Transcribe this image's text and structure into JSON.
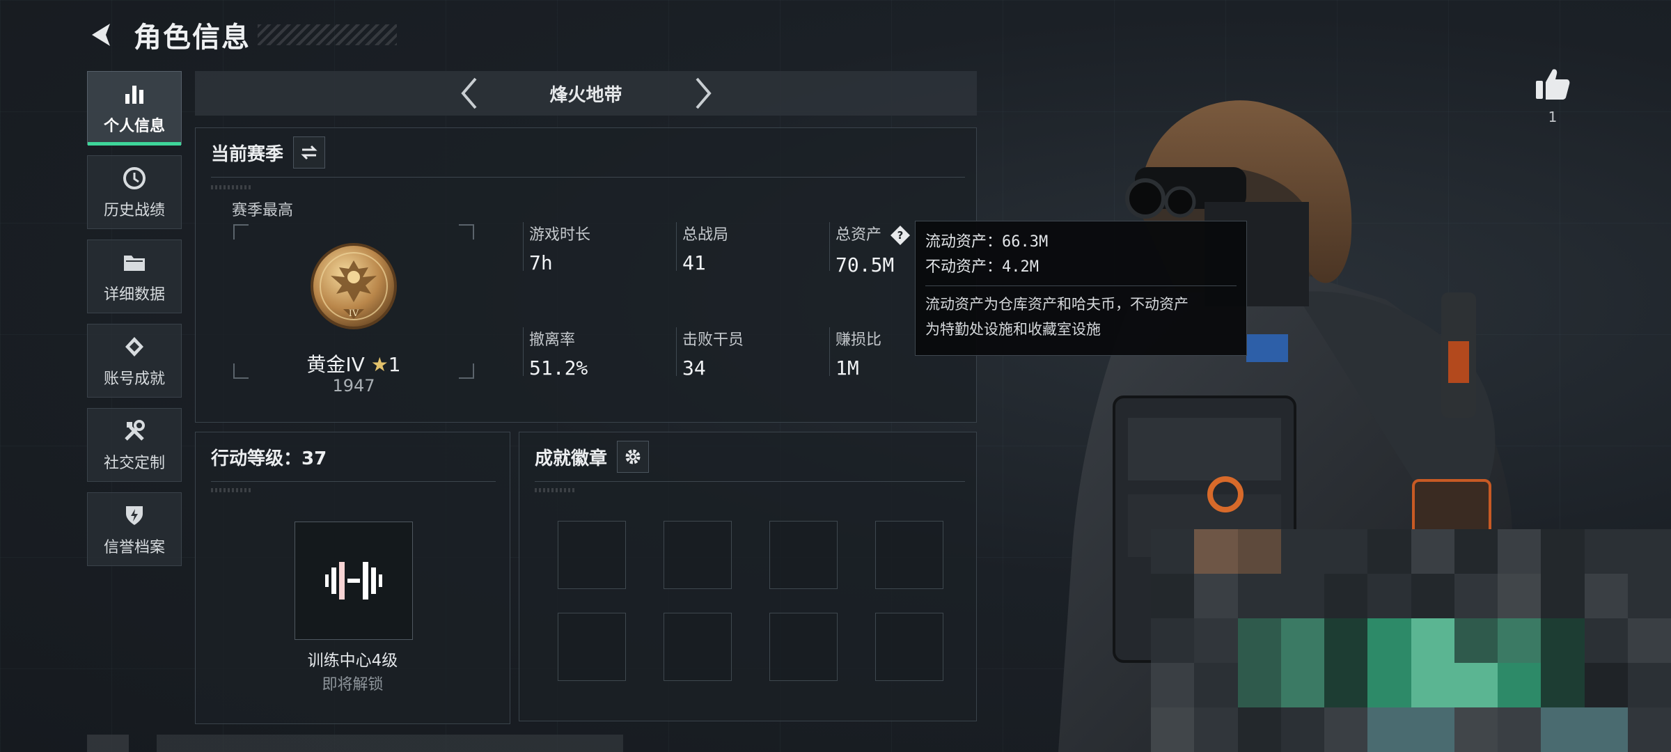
{
  "header": {
    "title": "角色信息"
  },
  "sidebar": {
    "items": [
      {
        "label": "个人信息",
        "icon": "bar-chart-icon",
        "active": true
      },
      {
        "label": "历史战绩",
        "icon": "history-icon"
      },
      {
        "label": "详细数据",
        "icon": "folder-icon"
      },
      {
        "label": "账号成就",
        "icon": "achievement-icon"
      },
      {
        "label": "社交定制",
        "icon": "tools-icon"
      },
      {
        "label": "信誉档案",
        "icon": "shield-icon"
      }
    ]
  },
  "mode": {
    "name": "烽火地带"
  },
  "season": {
    "title": "当前赛季",
    "best_label": "赛季最高",
    "rank": {
      "name": "黄金IV",
      "stars": "1",
      "score": "1947",
      "medal_numeral": "IV"
    },
    "stats": [
      {
        "label": "游戏时长",
        "value": "7h"
      },
      {
        "label": "总战局",
        "value": "41"
      },
      {
        "label": "总资产",
        "value": "70.5M"
      },
      {
        "label": "撤离率",
        "value": "51.2%"
      },
      {
        "label": "击败干员",
        "value": "34"
      },
      {
        "label": "赚损比",
        "value": "1M"
      }
    ]
  },
  "tooltip": {
    "liquid_label": "流动资产：",
    "liquid_value": "66.3M",
    "fixed_label": "不动资产：",
    "fixed_value": "4.2M",
    "desc_line1": "流动资产为仓库资产和哈夫币，不动资产",
    "desc_line2": "为特勤处设施和收藏室设施"
  },
  "action_level": {
    "title": "行动等级：37",
    "facility": "训练中心4级",
    "sub": "即将解锁"
  },
  "achievements": {
    "title": "成就徽章"
  },
  "likes": {
    "count": "1"
  },
  "colors": {
    "accent": "#3ed69a",
    "gold": "#e2c16b",
    "bg": "#1a1f24"
  }
}
